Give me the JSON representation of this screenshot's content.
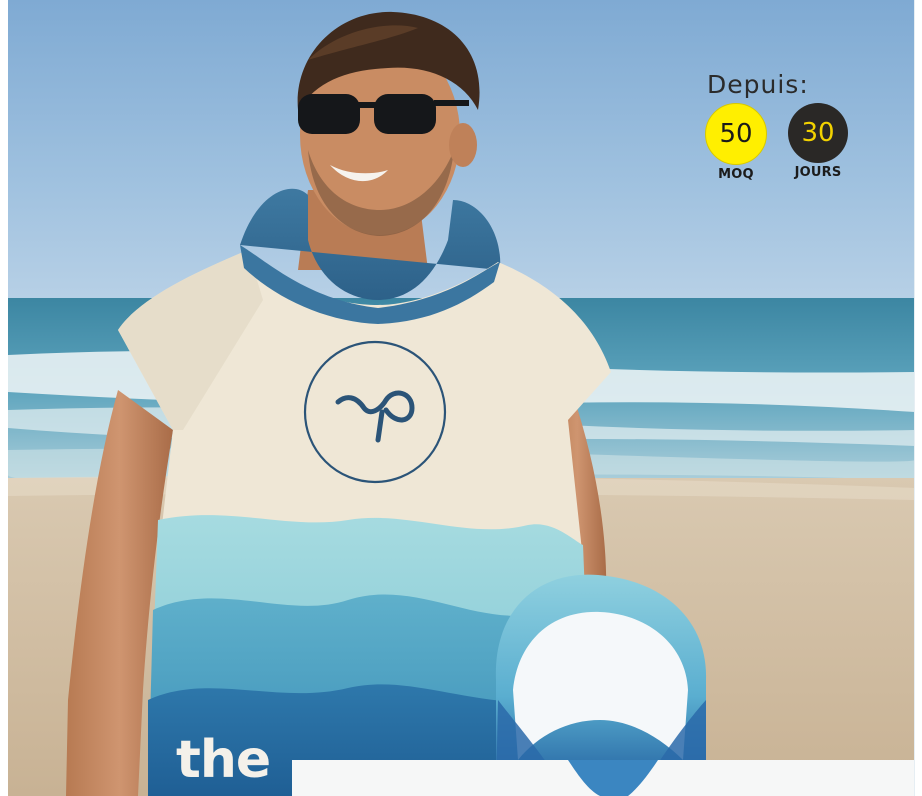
{
  "hero": {
    "subject": "man-in-hooded-poncho-on-beach",
    "colors": {
      "sky": "#8db3d6",
      "sea": "#3a8fb0",
      "sand": "#d8c7ad",
      "poncho_cream": "#efe7d6",
      "poncho_blue": "#2f78a8",
      "logo_navy": "#294e73"
    }
  },
  "offer": {
    "since_label": "Depuis:",
    "moq": {
      "value": "50",
      "label": "MOQ",
      "color": "#ffef00"
    },
    "lead_time": {
      "value": "30",
      "label": "JOURS",
      "color": "#2a2826"
    }
  },
  "product_print": {
    "wordmark_visible": "the"
  }
}
